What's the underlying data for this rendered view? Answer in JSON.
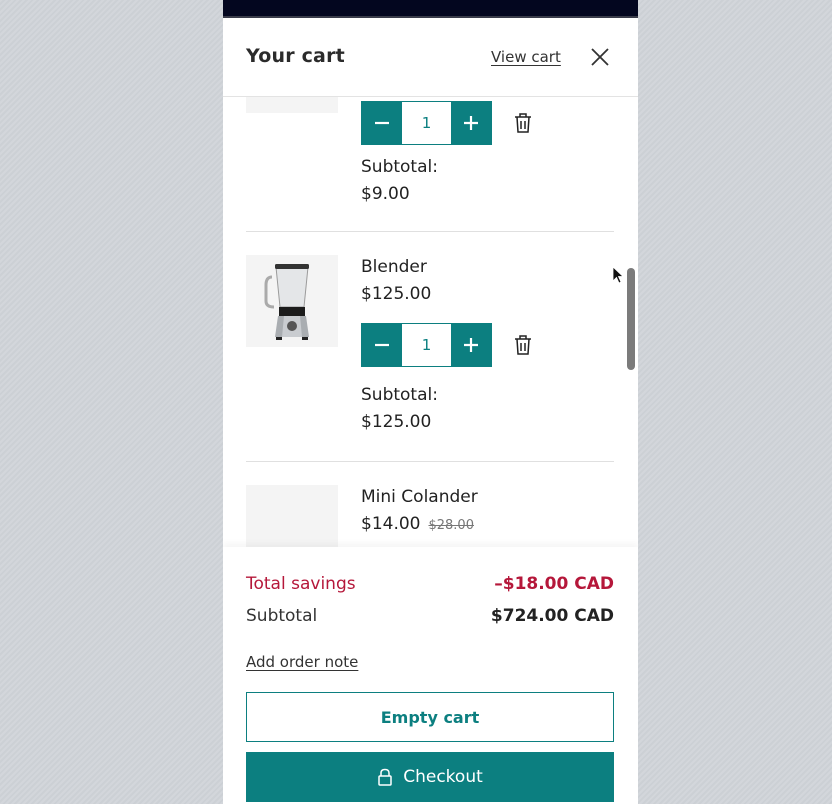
{
  "header": {
    "title": "Your cart",
    "view_cart_label": "View cart",
    "close_icon": "close-icon"
  },
  "items": [
    {
      "name": "",
      "quantity": "1",
      "subtotal_label": "Subtotal:",
      "subtotal_value": "$9.00"
    },
    {
      "name": "Blender",
      "price": "$125.00",
      "quantity": "1",
      "subtotal_label": "Subtotal:",
      "subtotal_value": "$125.00"
    },
    {
      "name": "Mini Colander",
      "price": "$14.00",
      "compare_price": "$28.00"
    }
  ],
  "stepper": {
    "minus_icon": "minus-icon",
    "plus_icon": "plus-icon",
    "remove_icon": "trash-icon"
  },
  "footer": {
    "savings_label": "Total savings",
    "savings_value": "–$18.00 CAD",
    "subtotal_label": "Subtotal",
    "subtotal_value": "$724.00 CAD",
    "order_note_label": "Add order note",
    "empty_cart_label": "Empty cart",
    "checkout_label": "Checkout",
    "checkout_icon": "lock-icon"
  },
  "colors": {
    "accent": "#0c7f80",
    "savings": "#b5173a",
    "topbar": "#03061f"
  }
}
